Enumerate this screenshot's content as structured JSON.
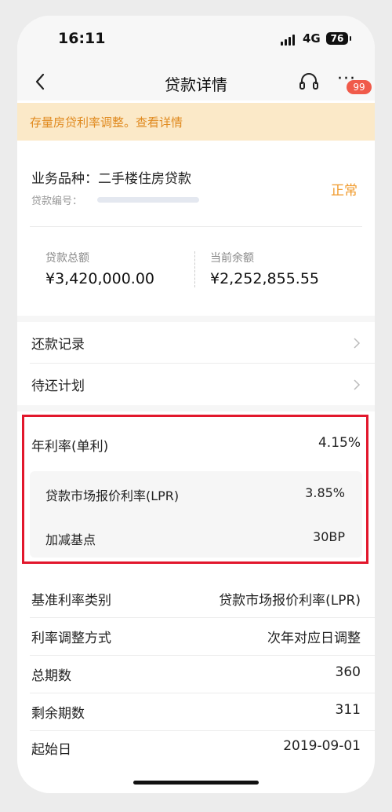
{
  "status_bar": {
    "time": "16:11",
    "network": "4G",
    "battery": "76"
  },
  "nav": {
    "title": "贷款详情",
    "badge_count": "99"
  },
  "notice": {
    "text": "存量房贷利率调整。查看详情"
  },
  "loan": {
    "product_label": "业务品种：二手楼住房贷款",
    "loan_no_label": "贷款编号：",
    "status": "正常",
    "total_label": "贷款总额",
    "total_value": "¥3,420,000.00",
    "balance_label": "当前余额",
    "balance_value": "¥2,252,855.55"
  },
  "links": [
    {
      "label": "还款记录"
    },
    {
      "label": "待还计划"
    }
  ],
  "rate": {
    "annual_label": "年利率(单利)",
    "annual_value": "4.15%",
    "lpr_label": "贷款市场报价利率(LPR)",
    "lpr_value": "3.85%",
    "bp_label": "加减基点",
    "bp_value": "30BP"
  },
  "details": [
    {
      "label": "基准利率类别",
      "value": "贷款市场报价利率(LPR)"
    },
    {
      "label": "利率调整方式",
      "value": "次年对应日调整"
    },
    {
      "label": "总期数",
      "value": "360"
    },
    {
      "label": "剩余期数",
      "value": "311"
    },
    {
      "label": "起始日",
      "value": "2019-09-01"
    }
  ],
  "colors": {
    "accent_orange": "#f0992a",
    "notice_bg": "#fbe9c8",
    "highlight_red": "#e2172c",
    "badge_red": "#f05a4a"
  },
  "icons": [
    "back-chevron-icon",
    "headset-icon",
    "more-dots-icon",
    "chevron-right-icon",
    "signal-icon",
    "battery-icon"
  ]
}
